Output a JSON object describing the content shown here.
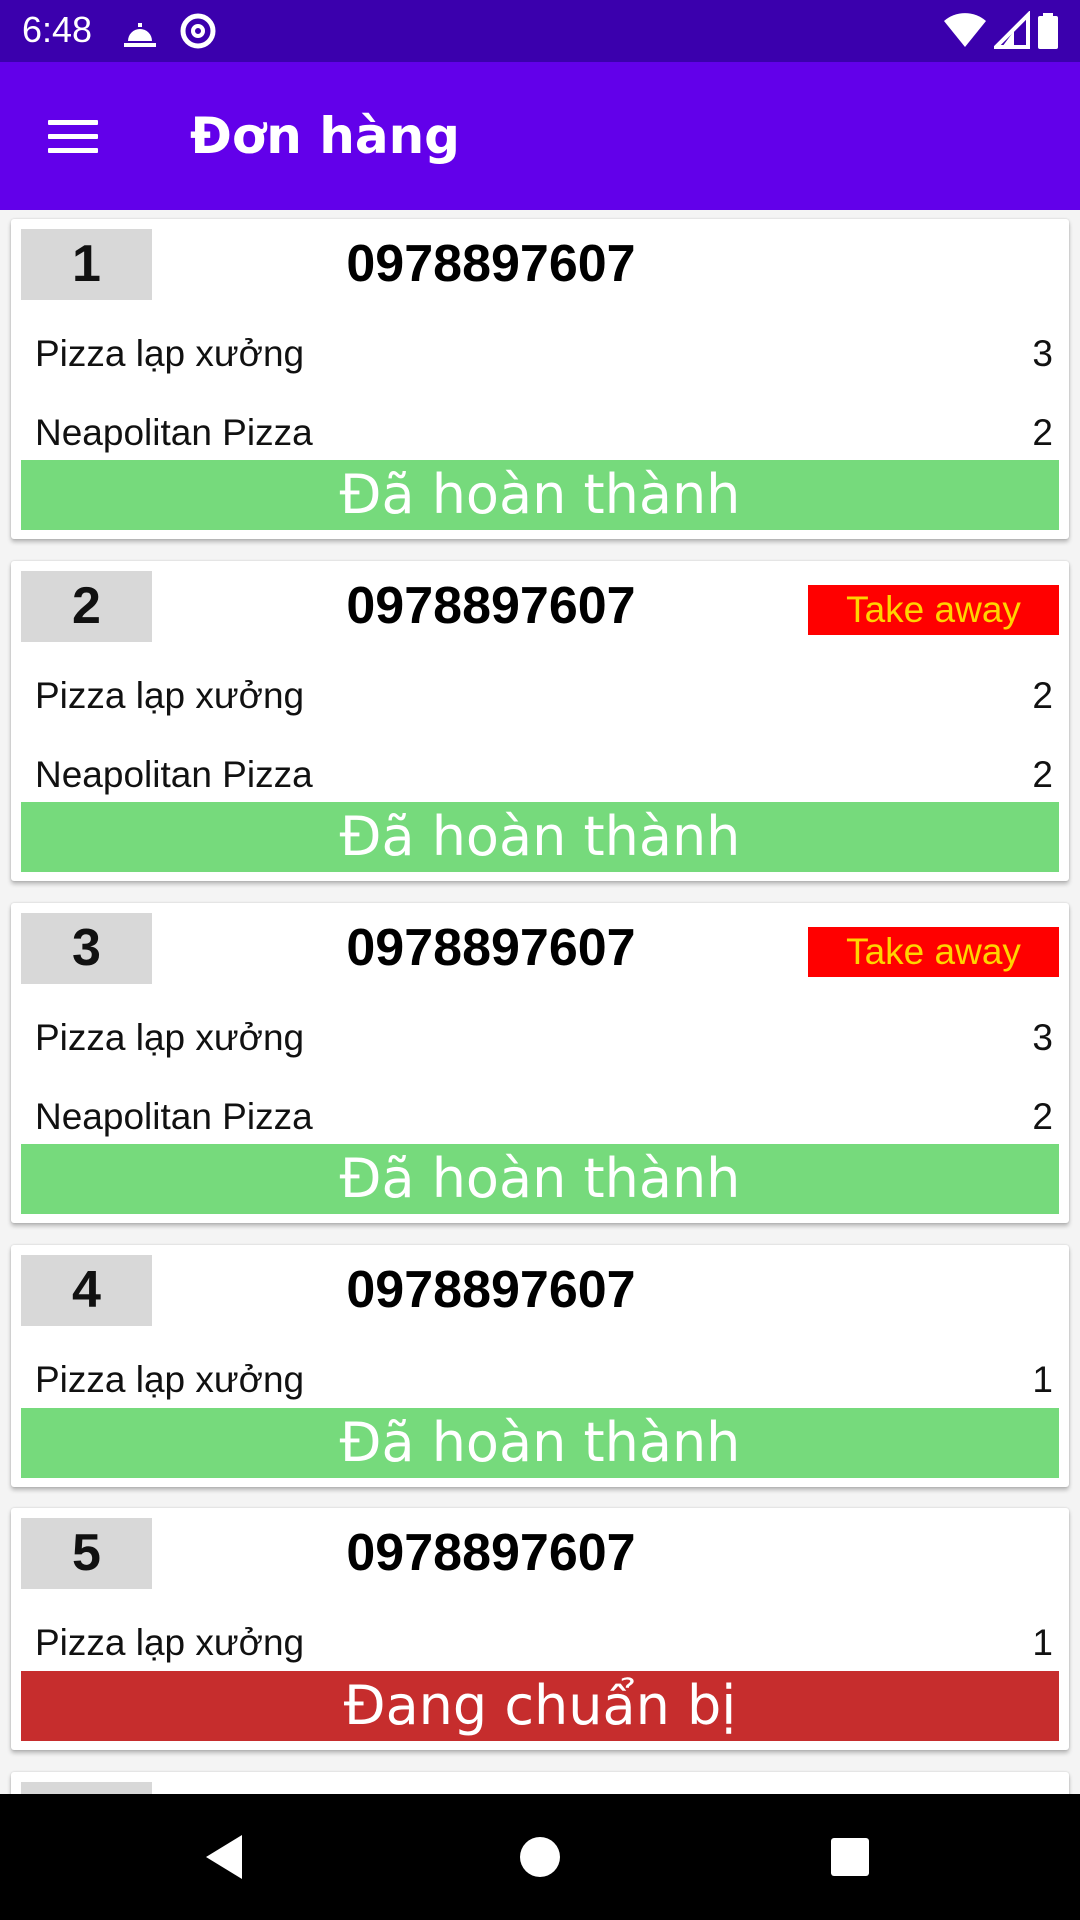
{
  "status_bar": {
    "time": "6:48",
    "left_icons": [
      "restaurant-notification-icon",
      "at-sign-icon"
    ],
    "right_icons": [
      "wifi-icon",
      "cellular-signal-icon",
      "battery-icon"
    ]
  },
  "app_bar": {
    "title": "Đơn hàng",
    "menu_icon": "hamburger-menu-icon"
  },
  "colors": {
    "status_bar": "#3b00ad",
    "app_bar": "#6200ea",
    "done": "#76da7c",
    "preparing": "#c62d2d",
    "takeaway_bg": "#ff0000",
    "takeaway_text": "#ffd400"
  },
  "orders": [
    {
      "number": "1",
      "phone": "0978897607",
      "takeaway": "",
      "items": [
        {
          "name": "Pizza lạp xưởng",
          "qty": "3"
        },
        {
          "name": "Neapolitan Pizza",
          "qty": "2"
        }
      ],
      "status": "Đã hoàn thành",
      "status_kind": "done"
    },
    {
      "number": "2",
      "phone": "0978897607",
      "takeaway": "Take away",
      "items": [
        {
          "name": "Pizza lạp xưởng",
          "qty": "2"
        },
        {
          "name": "Neapolitan Pizza",
          "qty": "2"
        }
      ],
      "status": "Đã hoàn thành",
      "status_kind": "done"
    },
    {
      "number": "3",
      "phone": "0978897607",
      "takeaway": "Take away",
      "items": [
        {
          "name": "Pizza lạp xưởng",
          "qty": "3"
        },
        {
          "name": "Neapolitan Pizza",
          "qty": "2"
        }
      ],
      "status": "Đã hoàn thành",
      "status_kind": "done"
    },
    {
      "number": "4",
      "phone": "0978897607",
      "takeaway": "",
      "items": [
        {
          "name": "Pizza lạp xưởng",
          "qty": "1"
        }
      ],
      "status": "Đã hoàn thành",
      "status_kind": "done"
    },
    {
      "number": "5",
      "phone": "0978897607",
      "takeaway": "",
      "items": [
        {
          "name": "Pizza lạp xưởng",
          "qty": "1"
        }
      ],
      "status": "Đang chuẩn bị",
      "status_kind": "preparing"
    }
  ],
  "nav_bar": {
    "icons": [
      "back-triangle-icon",
      "home-circle-icon",
      "recents-square-icon"
    ]
  }
}
